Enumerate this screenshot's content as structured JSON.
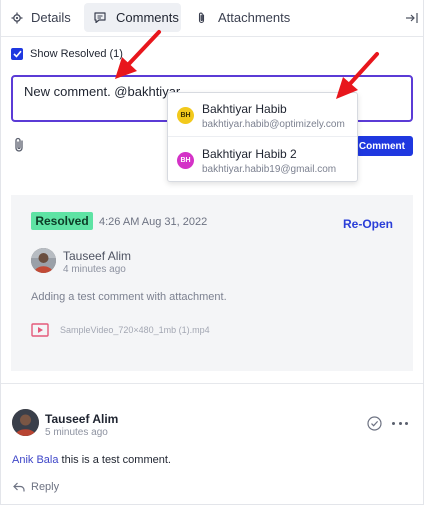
{
  "tabs": [
    {
      "label": "Details",
      "icon": "gear-icon"
    },
    {
      "label": "Comments",
      "icon": "comment-icon",
      "active": true
    },
    {
      "label": "Attachments",
      "icon": "paperclip-icon"
    }
  ],
  "show_resolved": {
    "label": "Show Resolved (1)",
    "checked": true
  },
  "comment_input": {
    "value": "New comment. @bakhtiyar"
  },
  "add_comment_button": {
    "label": "Comment"
  },
  "mention_suggestions": [
    {
      "initials": "BH",
      "name": "Bakhtiyar Habib",
      "email": "bakhtiyar.habib@optimizely.com",
      "color": "#f2c91c"
    },
    {
      "initials": "BH",
      "name": "Bakhtiyar Habib 2",
      "email": "bakhtiyar.habib19@gmail.com",
      "color": "#d432c7"
    }
  ],
  "resolved_thread": {
    "badge": "Resolved",
    "timestamp": "4:26 AM Aug 31, 2022",
    "reopen_label": "Re-Open",
    "author": "Tauseef Alim",
    "time_ago": "4 minutes ago",
    "body": "Adding a test comment with attachment.",
    "attachment": "SampleVideo_720×480_1mb (1).mp4"
  },
  "comment": {
    "author": "Tauseef Alim",
    "time_ago": "5 minutes ago",
    "mention": "Anik Bala",
    "body": " this is a test comment.",
    "reply_label": "Reply"
  },
  "colors": {
    "accent": "#1f38e0",
    "focus_border": "#5b3bd6",
    "resolved_badge": "#5ee3a4",
    "annotation_arrow": "#e8161c"
  }
}
